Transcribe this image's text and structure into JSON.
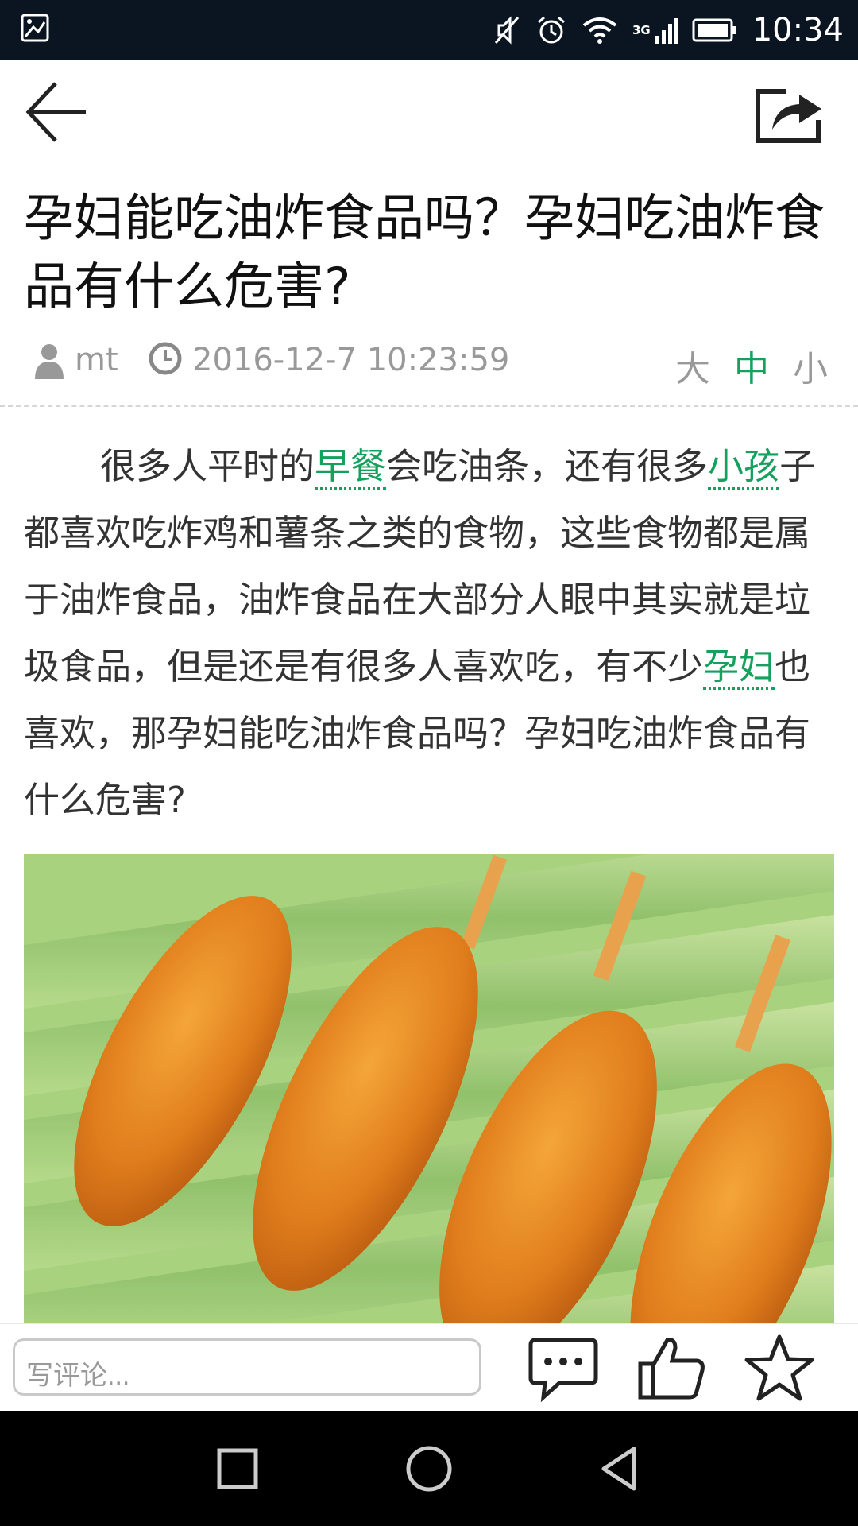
{
  "status_bar": {
    "network": "3G",
    "time": "10:34",
    "icons": [
      "image-icon",
      "mute-icon",
      "alarm-icon",
      "wifi-icon",
      "signal-icon",
      "battery-icon"
    ]
  },
  "header": {
    "back_icon": "arrow-left-icon",
    "share_icon": "share-icon"
  },
  "article": {
    "title": "孕妇能吃油炸食品吗？孕妇吃油炸食品有什么危害?",
    "author": "mt",
    "date": "2016-12-7 10:23:59",
    "font_sizes": [
      "大",
      "中",
      "小"
    ],
    "active_font_size": "中",
    "body": {
      "p1": "很多人平时的",
      "link1": "早餐",
      "p2": "会吃油条，还有很多",
      "link2": "小孩",
      "p3": "子都喜欢吃炸鸡和薯条之类的食物，这些食物都是属于油炸食品，油炸食品在大部分人眼中其实就是垃圾食品，但是还是有很多人喜欢吃，有不少",
      "link3": "孕妇",
      "p4": "也喜欢，那孕妇能吃油炸食品吗？孕妇吃油炸食品有什么危害?"
    }
  },
  "action_bar": {
    "comment_placeholder": "写评论...",
    "icons": [
      "comment-icon",
      "like-icon",
      "favorite-star-icon"
    ]
  },
  "nav_bar": {
    "icons": [
      "recent-apps-icon",
      "home-icon",
      "back-triangle-icon"
    ]
  },
  "colors": {
    "accent": "#16a05d",
    "status_bar": "#0b1522"
  }
}
